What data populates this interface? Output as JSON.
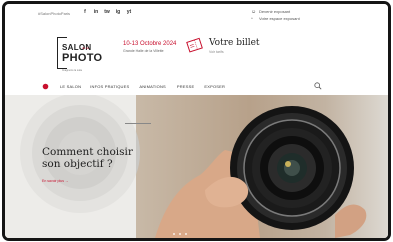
{
  "topbar": {
    "hashtag": "#SalonPhotoParis",
    "social": [
      "f",
      "in",
      "tw",
      "ig",
      "yt"
    ],
    "links": [
      {
        "icon": "user-icon",
        "label": "Devenir exposant"
      },
      {
        "icon": "lock-icon",
        "label": "Votre espace exposant"
      }
    ]
  },
  "header": {
    "logo": {
      "line1": "SALON",
      "line2": "de la",
      "line3": "PHOTO",
      "tagline": "Imaginons la suite"
    },
    "dates": "10-13 Octobre 2024",
    "venue": "Grande Halle de la Villette",
    "ticket": {
      "title": "Votre billet",
      "subtitle": "Voir tarifs"
    }
  },
  "nav": {
    "items": [
      "LE SALON",
      "INFOS PRATIQUES",
      "ANIMATIONS",
      "PRESSE",
      "EXPOSER"
    ]
  },
  "hero": {
    "headline": "Comment choisir son objectif ?",
    "cta": "En savoir plus"
  },
  "colors": {
    "accent": "#c8102e",
    "text": "#222222"
  }
}
